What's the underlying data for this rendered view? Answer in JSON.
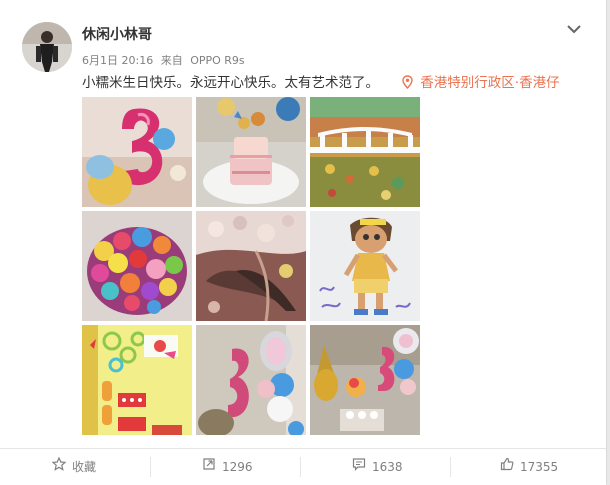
{
  "post": {
    "username": "休闲小林哥",
    "date": "6月1日 20:16",
    "source_prefix": "来自",
    "source": "OPPO R9s",
    "text": "小糯米生日快乐。永远开心快乐。太有艺术范了。",
    "location": "香港特别行政区·香港仔"
  },
  "actions": {
    "favorite_label": "收藏",
    "repost_count": "1296",
    "comment_count": "1638",
    "like_count": "17355"
  },
  "photos": [
    {
      "name": "photo-balloon-number",
      "desc_icon": "balloon"
    },
    {
      "name": "photo-birthday-cake",
      "desc_icon": "cake"
    },
    {
      "name": "photo-bridge-painting",
      "desc_icon": "painting"
    },
    {
      "name": "photo-flower-collage",
      "desc_icon": "collage"
    },
    {
      "name": "photo-feather-artwork",
      "desc_icon": "artwork"
    },
    {
      "name": "photo-dora-drawing",
      "desc_icon": "drawing"
    },
    {
      "name": "photo-handmade-card",
      "desc_icon": "card"
    },
    {
      "name": "photo-balloons-closeup",
      "desc_icon": "balloon"
    },
    {
      "name": "photo-balloons-room",
      "desc_icon": "balloon"
    }
  ],
  "colors": {
    "link": "#eb7350",
    "text": "#333333",
    "muted": "#808080"
  }
}
